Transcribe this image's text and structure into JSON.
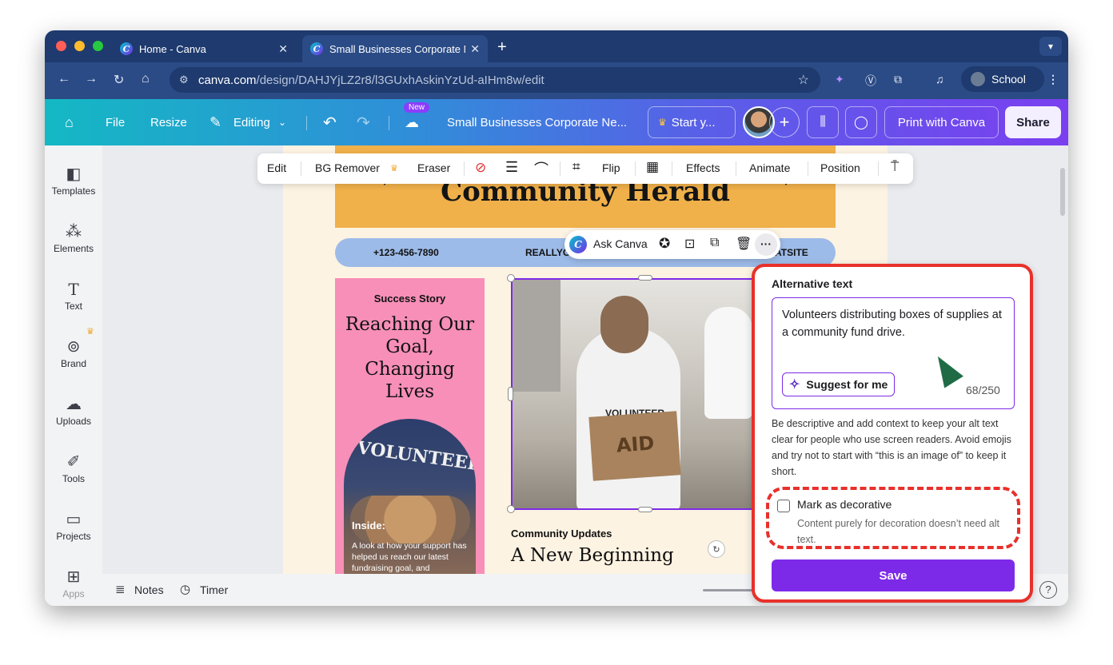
{
  "browser": {
    "tabs": [
      {
        "title": "Home - Canva",
        "active": false
      },
      {
        "title": "Small Businesses Corporate N",
        "active": true
      }
    ],
    "url_host": "canva.com",
    "url_path": "/design/DAHJYjLZ2r8/l3GUxhAskinYzUd-aIHm8w/edit",
    "profile_label": "School"
  },
  "header": {
    "file": "File",
    "resize": "Resize",
    "editing": "Editing",
    "new_badge": "New",
    "doc_title": "Small Businesses Corporate Ne...",
    "start_label": "Start y...",
    "print_label": "Print with Canva",
    "share_label": "Share"
  },
  "sidebar": {
    "items": [
      {
        "label": "Templates",
        "icon": "templates-icon"
      },
      {
        "label": "Elements",
        "icon": "elements-icon"
      },
      {
        "label": "Text",
        "icon": "text-icon"
      },
      {
        "label": "Brand",
        "icon": "brand-icon"
      },
      {
        "label": "Uploads",
        "icon": "uploads-icon"
      },
      {
        "label": "Tools",
        "icon": "tools-icon"
      },
      {
        "label": "Projects",
        "icon": "projects-icon"
      },
      {
        "label": "Apps",
        "icon": "apps-icon"
      }
    ]
  },
  "element_toolbar": {
    "edit": "Edit",
    "bg_remover": "BG Remover",
    "eraser": "Eraser",
    "flip": "Flip",
    "effects": "Effects",
    "animate": "Animate",
    "position": "Position"
  },
  "ask_toolbar": {
    "ask_canva": "Ask Canva"
  },
  "design": {
    "masthead_title": "Community Herald",
    "phone": "+123-456-7890",
    "contact_mid": "REALLYG",
    "contact_right": "ATSITE",
    "story_label": "Success Story",
    "story_headline": "Reaching Our Goal, Changing Lives",
    "arch_text": "VOLUNTEER",
    "inside_label": "Inside:",
    "inside_text": "A look at how your support has helped us reach our latest fundraising goal, and",
    "photo_shirt": "VOLUNTEER",
    "photo_box": "AID",
    "updates_label": "Community Updates",
    "updates_headline": "A New Beginning"
  },
  "alt_panel": {
    "title": "Alternative text",
    "alt_value": "Volunteers distributing boxes of supplies at a community fund drive.",
    "suggest": "Suggest for me",
    "char_count": "68/250",
    "help": "Be descriptive and add context to keep your alt text clear for people who use screen readers. Avoid emojis and try not to start with “this is an image of” to keep it short.",
    "decorative_label": "Mark as decorative",
    "decorative_sub": "Content purely for decoration doesn’t need alt text.",
    "decorative_checked": false,
    "save": "Save"
  },
  "bottom": {
    "notes": "Notes",
    "timer": "Timer"
  },
  "colors": {
    "canva_purple": "#7d2ae8",
    "highlight_red": "#e8302a",
    "masthead": "#f0b04a",
    "pink_column": "#f78fb8",
    "contact_bar": "#9dbbe8"
  }
}
